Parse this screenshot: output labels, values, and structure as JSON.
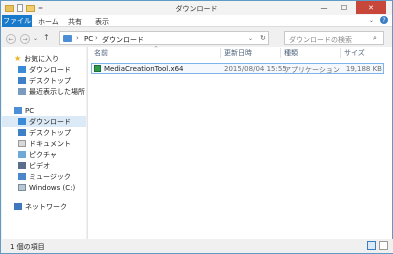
{
  "window": {
    "title": "ダウンロード",
    "minimize": "—",
    "maximize": "☐",
    "close": "✕"
  },
  "ribbon": {
    "tabs": [
      "ファイル",
      "ホーム",
      "共有",
      "表示"
    ]
  },
  "address": {
    "segments": [
      "PC",
      "ダウンロード"
    ],
    "search_placeholder": "ダウンロードの検索"
  },
  "sidebar": {
    "favorites_header": "お気に入り",
    "favorites": [
      "ダウンロード",
      "デスクトップ",
      "最近表示した場所"
    ],
    "pc_header": "PC",
    "pc_items": [
      "ダウンロード",
      "デスクトップ",
      "ドキュメント",
      "ピクチャ",
      "ビデオ",
      "ミュージック",
      "Windows (C:)"
    ],
    "network": "ネットワーク"
  },
  "columns": {
    "name": "名前",
    "date": "更新日時",
    "type": "種類",
    "size": "サイズ"
  },
  "files": [
    {
      "name": "MediaCreationTool.x64",
      "date": "2015/08/04 15:55",
      "type": "アプリケーション",
      "size": "19,188 KB"
    }
  ],
  "status": {
    "count": "1 個の項目"
  },
  "colors": {
    "accent": "#1979ca",
    "selection": "#dceaf7",
    "close": "#c7473a"
  }
}
